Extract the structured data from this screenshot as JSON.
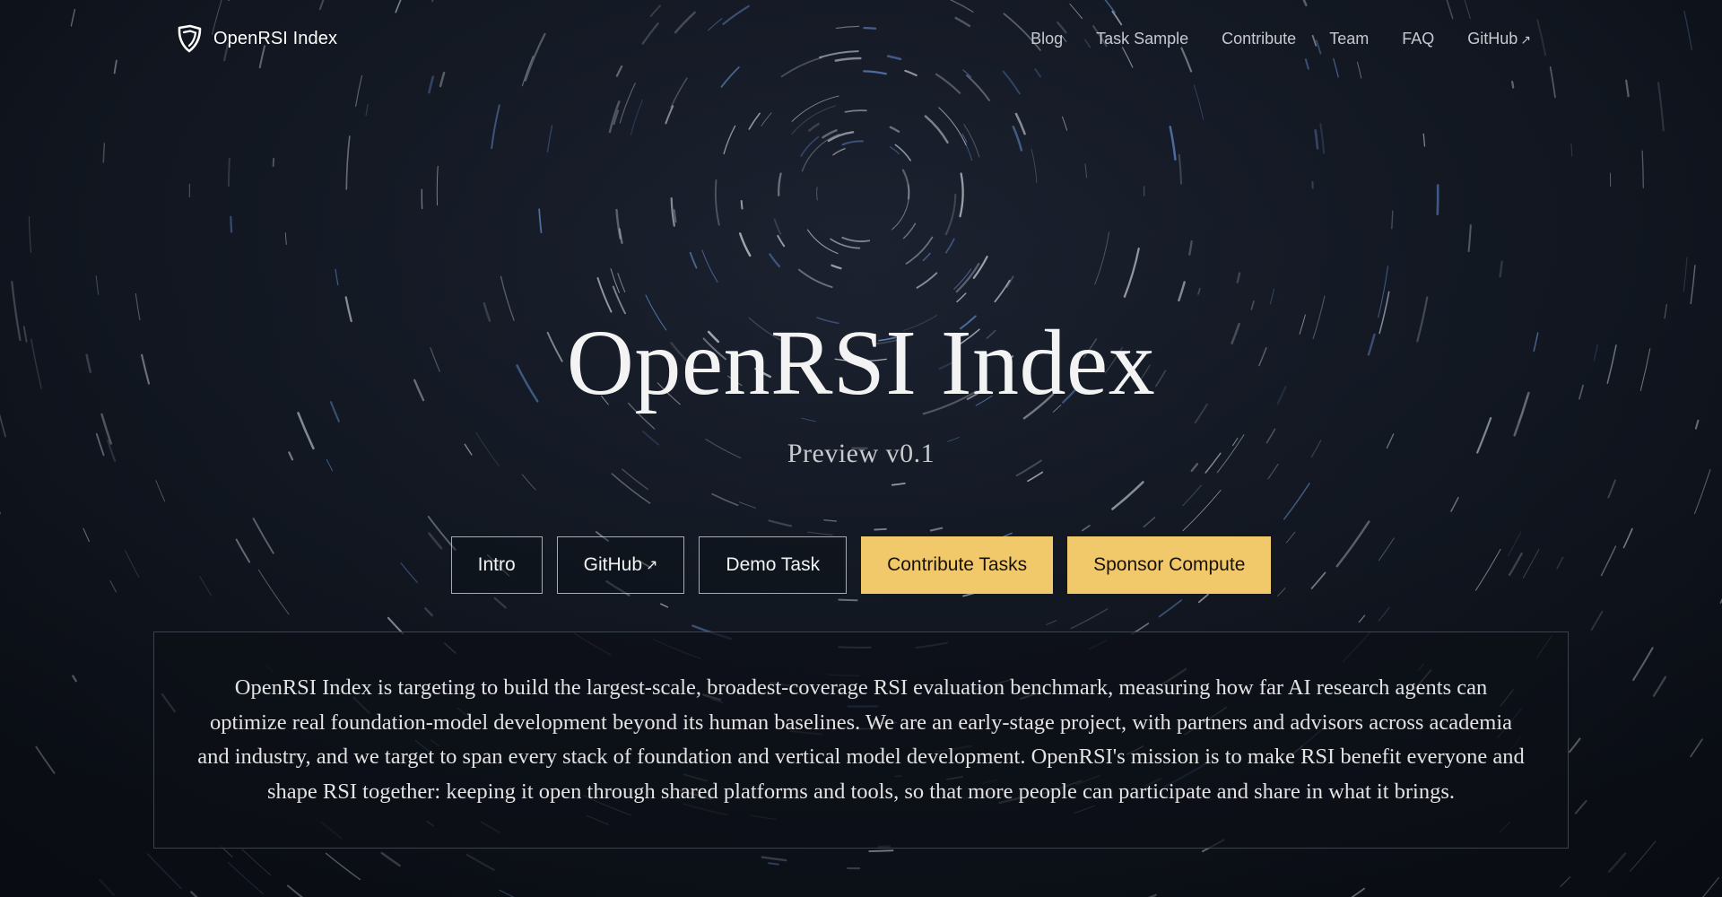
{
  "header": {
    "brand_name": "OpenRSI Index",
    "brand_icon": "shield-logo-icon",
    "nav": [
      {
        "label": "Blog"
      },
      {
        "label": "Task Sample"
      },
      {
        "label": "Contribute"
      },
      {
        "label": "Team"
      },
      {
        "label": "FAQ"
      },
      {
        "label": "GitHub",
        "external_icon": "↗"
      }
    ]
  },
  "hero": {
    "title": "OpenRSI Index",
    "subtitle": "Preview v0.1",
    "buttons": [
      {
        "label": "Intro",
        "style": "outline"
      },
      {
        "label": "GitHub",
        "external_icon": "↗",
        "style": "outline"
      },
      {
        "label": "Demo Task",
        "style": "outline"
      },
      {
        "label": "Contribute Tasks",
        "style": "solid"
      },
      {
        "label": "Sponsor Compute",
        "style": "solid"
      }
    ]
  },
  "mission": {
    "text": "OpenRSI Index is targeting to build the largest-scale, broadest-coverage RSI evaluation benchmark, measuring how far AI research agents can optimize real foundation-model development beyond its human baselines. We are an early-stage project, with partners and advisors across academia and industry, and we target to span every stack of foundation and vertical model development. OpenRSI's mission is to make RSI benefit everyone and shape RSI together: keeping it open through shared platforms and tools, so that more people can participate and share in what it brings."
  },
  "colors": {
    "background": "#0f141d",
    "accent_button": "#f1c96b",
    "accent_button_text": "#17130a",
    "star_blue": "#6f9ee6"
  }
}
